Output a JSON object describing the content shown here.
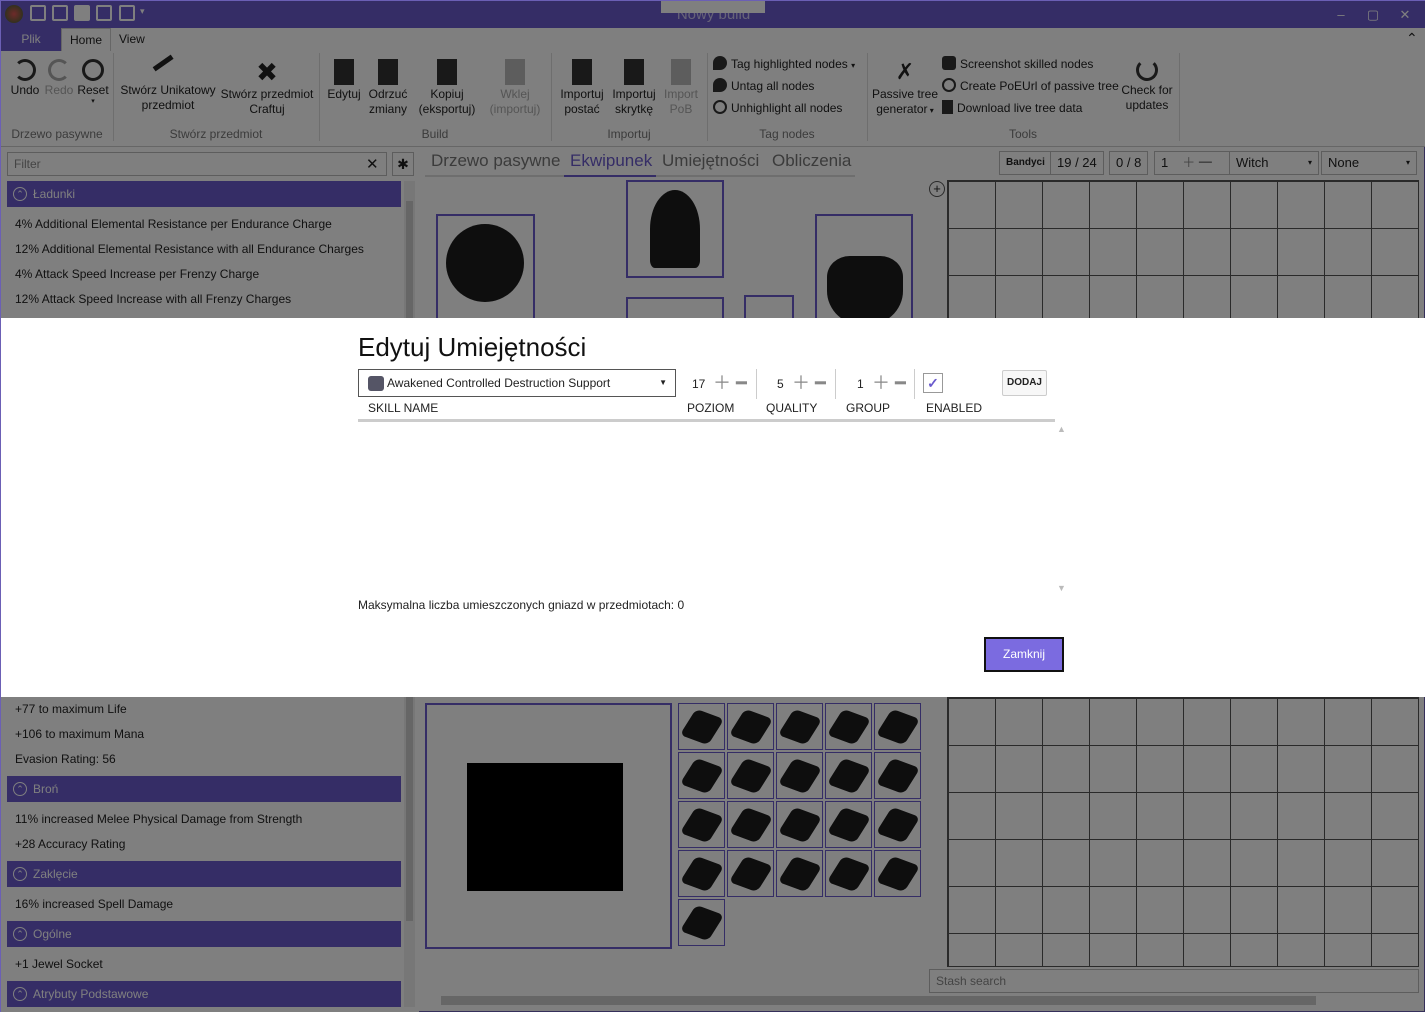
{
  "window": {
    "title": "Nowy build"
  },
  "ribbon_tabs": [
    "Plik",
    "Home",
    "View"
  ],
  "ribbon": {
    "undo": "Undo",
    "redo": "Redo",
    "reset": "Reset",
    "group_tree": "Drzewo pasywne",
    "create_unique": "Stwórz Unikatowy\npredmiot",
    "create_unique_l1": "Stwórz Unikatowy",
    "create_unique_l2": "przedmiot",
    "create_craft_l1": "Stwórz przedmiot",
    "create_craft_l2": "Craftuj",
    "group_item": "Stwórz przedmiot",
    "edit": "Edytuj",
    "discard_l1": "Odrzuć",
    "discard_l2": "zmiany",
    "copy_l1": "Kopiuj",
    "copy_l2": "(eksportuj)",
    "paste_l1": "Wklej",
    "paste_l2": "(importuj)",
    "group_build": "Build",
    "import_char_l1": "Importuj",
    "import_char_l2": "postać",
    "import_stash_l1": "Importuj",
    "import_stash_l2": "skrytkę",
    "import_pob_l1": "Import",
    "import_pob_l2": "PoB",
    "group_import": "Importuj",
    "tag_highlighted": "Tag highlighted nodes",
    "untag_all": "Untag all nodes",
    "unhighlight_all": "Unhighlight all nodes",
    "group_tag": "Tag nodes",
    "passive_gen_l1": "Passive tree",
    "passive_gen_l2": "generator",
    "screenshot": "Screenshot skilled nodes",
    "create_poeurl": "Create PoEUrl of passive tree",
    "download_tree": "Download live tree data",
    "check_l1": "Check for",
    "check_l2": "updates",
    "group_tools": "Tools"
  },
  "left_panel": {
    "filter_placeholder": "Filter",
    "groups": [
      {
        "name": "Ładunki",
        "items": [
          "4% Additional Elemental Resistance per Endurance Charge",
          "12% Additional Elemental Resistance with all Endurance Charges",
          "4% Attack Speed Increase per Frenzy Charge",
          "12% Attack Speed Increase with all Frenzy Charges"
        ]
      },
      {
        "name": "",
        "items": [
          "+77 to maximum Life",
          "+106 to maximum Mana",
          "Evasion Rating: 56"
        ]
      },
      {
        "name": "Broń",
        "items": [
          "11% increased Melee Physical Damage from Strength",
          "+28 Accuracy Rating"
        ]
      },
      {
        "name": "Zaklęcie",
        "items": [
          "16% increased Spell Damage"
        ]
      },
      {
        "name": "Ogólne",
        "items": [
          "+1 Jewel Socket"
        ]
      },
      {
        "name": "Atrybuty Podstawowe",
        "items": []
      }
    ]
  },
  "main_tabs": [
    "Drzewo pasywne",
    "Ekwipunek",
    "Umiejętności",
    "Obliczenia"
  ],
  "toolbar": {
    "bandits": "Bandyci",
    "points": "19 / 24",
    "ascend": "0 / 8",
    "level": "1",
    "class": "Witch",
    "ascendancy": "None"
  },
  "stash_search_placeholder": "Stash search",
  "dialog": {
    "title": "Edytuj Umiejętności",
    "selected_gem": "Awakened Controlled Destruction Support",
    "level": "17",
    "quality": "5",
    "group": "1",
    "add_button": "DODAJ",
    "columns": [
      "SKILL NAME",
      "POZIOM",
      "QUALITY",
      "GROUP",
      "ENABLED"
    ],
    "max_sockets": "Maksymalna liczba umieszczonych gniazd w przedmiotach: 0",
    "close_button": "Zamknij"
  },
  "colors": {
    "accent": "#6a5acd",
    "button": "#7b6be0"
  }
}
